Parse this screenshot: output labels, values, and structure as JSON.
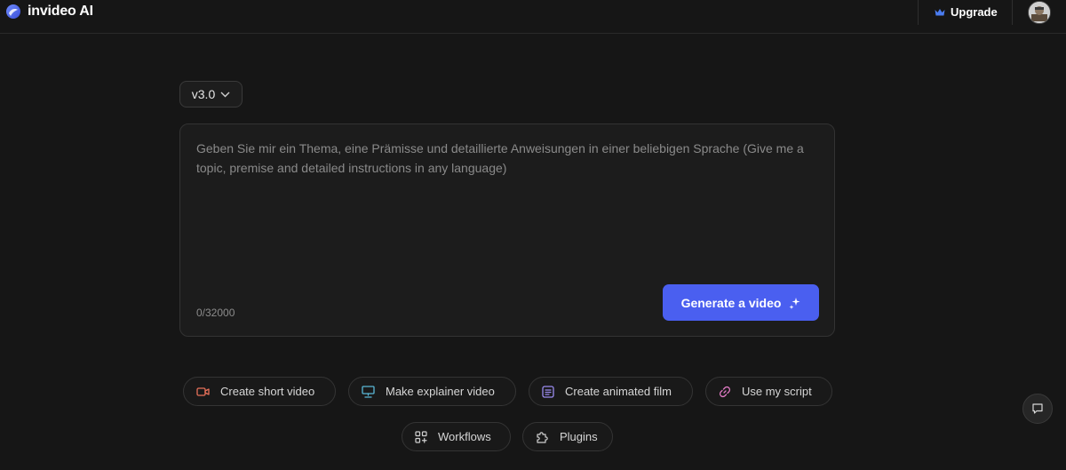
{
  "app": {
    "name": "invideo AI"
  },
  "header": {
    "upgrade_label": "Upgrade"
  },
  "version_selector": {
    "value": "v3.0"
  },
  "prompt": {
    "placeholder": "Geben Sie mir ein Thema, eine Prämisse und detaillierte Anweisungen in einer beliebigen Sprache (Give me a topic, premise and detailed instructions in any language)",
    "value": "",
    "char_count": "0/32000",
    "generate_label": "Generate a video"
  },
  "quick_actions": [
    {
      "label": "Create short video",
      "icon": "video-camera-icon",
      "color": "#e8715a"
    },
    {
      "label": "Make explainer video",
      "icon": "presentation-icon",
      "color": "#5ab8d6"
    },
    {
      "label": "Create animated film",
      "icon": "film-list-icon",
      "color": "#9b8cf0"
    },
    {
      "label": "Use my script",
      "icon": "link-icon",
      "color": "#e07ac4"
    },
    {
      "label": "Workflows",
      "icon": "grid-plus-icon",
      "color": "#d0d0d0"
    },
    {
      "label": "Plugins",
      "icon": "puzzle-icon",
      "color": "#d0d0d0"
    }
  ],
  "colors": {
    "background": "#161616",
    "accent": "#4a5ff0",
    "upgrade_crown": "#4a7cf0"
  }
}
